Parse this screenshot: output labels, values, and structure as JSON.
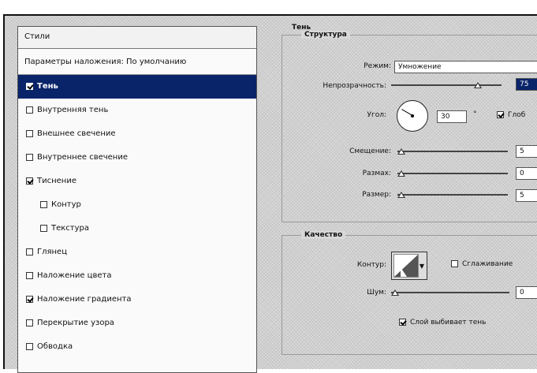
{
  "styles": {
    "header": "Стили",
    "blending": "Параметры наложения: По умолчанию",
    "items": [
      {
        "label": "Тень",
        "checked": true,
        "selected": true,
        "sub": false
      },
      {
        "label": "Внутренняя тень",
        "checked": false,
        "selected": false,
        "sub": false
      },
      {
        "label": "Внешнее свечение",
        "checked": false,
        "selected": false,
        "sub": false
      },
      {
        "label": "Внутреннее свечение",
        "checked": false,
        "selected": false,
        "sub": false
      },
      {
        "label": "Тиснение",
        "checked": true,
        "selected": false,
        "sub": false
      },
      {
        "label": "Контур",
        "checked": false,
        "selected": false,
        "sub": true
      },
      {
        "label": "Текстура",
        "checked": false,
        "selected": false,
        "sub": true
      },
      {
        "label": "Глянец",
        "checked": false,
        "selected": false,
        "sub": false
      },
      {
        "label": "Наложение цвета",
        "checked": false,
        "selected": false,
        "sub": false
      },
      {
        "label": "Наложение градиента",
        "checked": true,
        "selected": false,
        "sub": false
      },
      {
        "label": "Перекрытие узора",
        "checked": false,
        "selected": false,
        "sub": false
      },
      {
        "label": "Обводка",
        "checked": false,
        "selected": false,
        "sub": false
      }
    ]
  },
  "shadow": {
    "title": "Тень",
    "structure": {
      "legend": "Структура",
      "mode_label": "Режим:",
      "mode_value": "Умножение",
      "opacity_label": "Непрозрачность:",
      "opacity_value": "75",
      "opacity_level": 0.75,
      "angle_label": "Угол:",
      "angle_value": "30",
      "angle_unit": "°",
      "global_label": "Глоб",
      "global_checked": true,
      "offset_label": "Смещение:",
      "offset_value": "5",
      "spread_label": "Размах:",
      "spread_value": "0",
      "size_label": "Размер:",
      "size_value": "5"
    },
    "quality": {
      "legend": "Качество",
      "contour_label": "Контур:",
      "antialias_label": "Сглаживание",
      "antialias_checked": false,
      "noise_label": "Шум:",
      "noise_value": "0",
      "knockout_label": "Слой выбивает тень",
      "knockout_checked": true
    }
  },
  "icons": {
    "checkbox": "checkbox-icon",
    "dial": "angle-dial-icon",
    "arrow": "chevron-down-icon",
    "cursor": "mouse-pointer-icon"
  },
  "colors": {
    "selection": "#0a246a",
    "panel_bg": "#d8d8d8"
  }
}
